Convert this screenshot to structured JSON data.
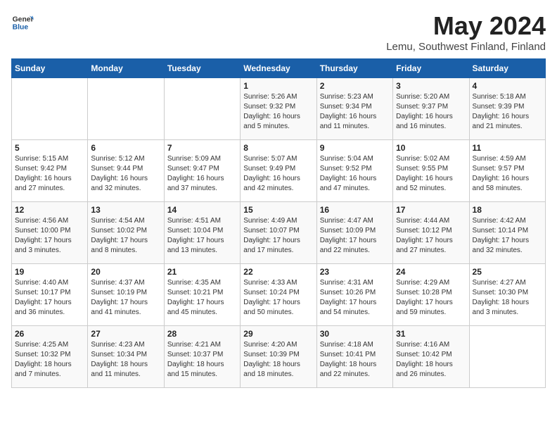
{
  "header": {
    "logo_general": "General",
    "logo_blue": "Blue",
    "title": "May 2024",
    "location": "Lemu, Southwest Finland, Finland"
  },
  "weekdays": [
    "Sunday",
    "Monday",
    "Tuesday",
    "Wednesday",
    "Thursday",
    "Friday",
    "Saturday"
  ],
  "weeks": [
    [
      {
        "day": "",
        "sunrise": "",
        "sunset": "",
        "daylight": ""
      },
      {
        "day": "",
        "sunrise": "",
        "sunset": "",
        "daylight": ""
      },
      {
        "day": "",
        "sunrise": "",
        "sunset": "",
        "daylight": ""
      },
      {
        "day": "1",
        "sunrise": "Sunrise: 5:26 AM",
        "sunset": "Sunset: 9:32 PM",
        "daylight": "Daylight: 16 hours and 5 minutes."
      },
      {
        "day": "2",
        "sunrise": "Sunrise: 5:23 AM",
        "sunset": "Sunset: 9:34 PM",
        "daylight": "Daylight: 16 hours and 11 minutes."
      },
      {
        "day": "3",
        "sunrise": "Sunrise: 5:20 AM",
        "sunset": "Sunset: 9:37 PM",
        "daylight": "Daylight: 16 hours and 16 minutes."
      },
      {
        "day": "4",
        "sunrise": "Sunrise: 5:18 AM",
        "sunset": "Sunset: 9:39 PM",
        "daylight": "Daylight: 16 hours and 21 minutes."
      }
    ],
    [
      {
        "day": "5",
        "sunrise": "Sunrise: 5:15 AM",
        "sunset": "Sunset: 9:42 PM",
        "daylight": "Daylight: 16 hours and 27 minutes."
      },
      {
        "day": "6",
        "sunrise": "Sunrise: 5:12 AM",
        "sunset": "Sunset: 9:44 PM",
        "daylight": "Daylight: 16 hours and 32 minutes."
      },
      {
        "day": "7",
        "sunrise": "Sunrise: 5:09 AM",
        "sunset": "Sunset: 9:47 PM",
        "daylight": "Daylight: 16 hours and 37 minutes."
      },
      {
        "day": "8",
        "sunrise": "Sunrise: 5:07 AM",
        "sunset": "Sunset: 9:49 PM",
        "daylight": "Daylight: 16 hours and 42 minutes."
      },
      {
        "day": "9",
        "sunrise": "Sunrise: 5:04 AM",
        "sunset": "Sunset: 9:52 PM",
        "daylight": "Daylight: 16 hours and 47 minutes."
      },
      {
        "day": "10",
        "sunrise": "Sunrise: 5:02 AM",
        "sunset": "Sunset: 9:55 PM",
        "daylight": "Daylight: 16 hours and 52 minutes."
      },
      {
        "day": "11",
        "sunrise": "Sunrise: 4:59 AM",
        "sunset": "Sunset: 9:57 PM",
        "daylight": "Daylight: 16 hours and 58 minutes."
      }
    ],
    [
      {
        "day": "12",
        "sunrise": "Sunrise: 4:56 AM",
        "sunset": "Sunset: 10:00 PM",
        "daylight": "Daylight: 17 hours and 3 minutes."
      },
      {
        "day": "13",
        "sunrise": "Sunrise: 4:54 AM",
        "sunset": "Sunset: 10:02 PM",
        "daylight": "Daylight: 17 hours and 8 minutes."
      },
      {
        "day": "14",
        "sunrise": "Sunrise: 4:51 AM",
        "sunset": "Sunset: 10:04 PM",
        "daylight": "Daylight: 17 hours and 13 minutes."
      },
      {
        "day": "15",
        "sunrise": "Sunrise: 4:49 AM",
        "sunset": "Sunset: 10:07 PM",
        "daylight": "Daylight: 17 hours and 17 minutes."
      },
      {
        "day": "16",
        "sunrise": "Sunrise: 4:47 AM",
        "sunset": "Sunset: 10:09 PM",
        "daylight": "Daylight: 17 hours and 22 minutes."
      },
      {
        "day": "17",
        "sunrise": "Sunrise: 4:44 AM",
        "sunset": "Sunset: 10:12 PM",
        "daylight": "Daylight: 17 hours and 27 minutes."
      },
      {
        "day": "18",
        "sunrise": "Sunrise: 4:42 AM",
        "sunset": "Sunset: 10:14 PM",
        "daylight": "Daylight: 17 hours and 32 minutes."
      }
    ],
    [
      {
        "day": "19",
        "sunrise": "Sunrise: 4:40 AM",
        "sunset": "Sunset: 10:17 PM",
        "daylight": "Daylight: 17 hours and 36 minutes."
      },
      {
        "day": "20",
        "sunrise": "Sunrise: 4:37 AM",
        "sunset": "Sunset: 10:19 PM",
        "daylight": "Daylight: 17 hours and 41 minutes."
      },
      {
        "day": "21",
        "sunrise": "Sunrise: 4:35 AM",
        "sunset": "Sunset: 10:21 PM",
        "daylight": "Daylight: 17 hours and 45 minutes."
      },
      {
        "day": "22",
        "sunrise": "Sunrise: 4:33 AM",
        "sunset": "Sunset: 10:24 PM",
        "daylight": "Daylight: 17 hours and 50 minutes."
      },
      {
        "day": "23",
        "sunrise": "Sunrise: 4:31 AM",
        "sunset": "Sunset: 10:26 PM",
        "daylight": "Daylight: 17 hours and 54 minutes."
      },
      {
        "day": "24",
        "sunrise": "Sunrise: 4:29 AM",
        "sunset": "Sunset: 10:28 PM",
        "daylight": "Daylight: 17 hours and 59 minutes."
      },
      {
        "day": "25",
        "sunrise": "Sunrise: 4:27 AM",
        "sunset": "Sunset: 10:30 PM",
        "daylight": "Daylight: 18 hours and 3 minutes."
      }
    ],
    [
      {
        "day": "26",
        "sunrise": "Sunrise: 4:25 AM",
        "sunset": "Sunset: 10:32 PM",
        "daylight": "Daylight: 18 hours and 7 minutes."
      },
      {
        "day": "27",
        "sunrise": "Sunrise: 4:23 AM",
        "sunset": "Sunset: 10:34 PM",
        "daylight": "Daylight: 18 hours and 11 minutes."
      },
      {
        "day": "28",
        "sunrise": "Sunrise: 4:21 AM",
        "sunset": "Sunset: 10:37 PM",
        "daylight": "Daylight: 18 hours and 15 minutes."
      },
      {
        "day": "29",
        "sunrise": "Sunrise: 4:20 AM",
        "sunset": "Sunset: 10:39 PM",
        "daylight": "Daylight: 18 hours and 18 minutes."
      },
      {
        "day": "30",
        "sunrise": "Sunrise: 4:18 AM",
        "sunset": "Sunset: 10:41 PM",
        "daylight": "Daylight: 18 hours and 22 minutes."
      },
      {
        "day": "31",
        "sunrise": "Sunrise: 4:16 AM",
        "sunset": "Sunset: 10:42 PM",
        "daylight": "Daylight: 18 hours and 26 minutes."
      },
      {
        "day": "",
        "sunrise": "",
        "sunset": "",
        "daylight": ""
      }
    ]
  ]
}
